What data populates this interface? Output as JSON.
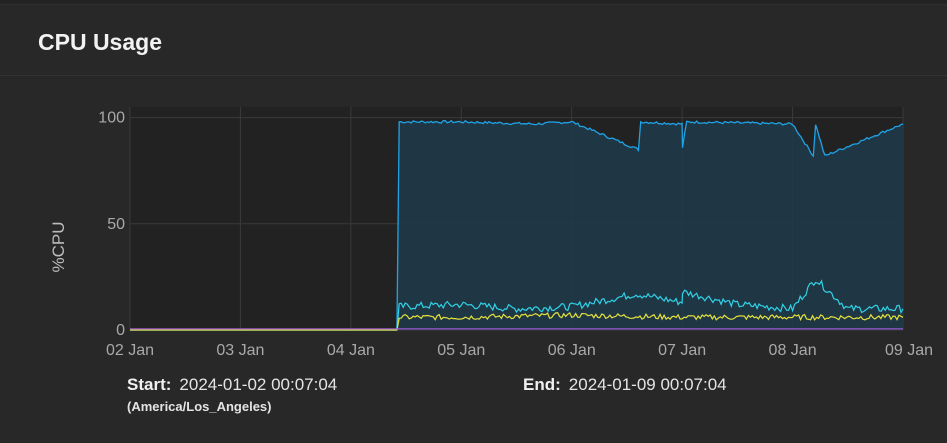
{
  "card": {
    "title": "CPU Usage"
  },
  "chart_data": {
    "type": "area",
    "title": "",
    "xlabel": "",
    "ylabel": "%CPU",
    "x_ticks": [
      "02 Jan",
      "03 Jan",
      "04 Jan",
      "05 Jan",
      "06 Jan",
      "07 Jan",
      "08 Jan",
      "09 Jan"
    ],
    "xlim": [
      "2024-01-02",
      "2024-01-09"
    ],
    "y_ticks": [
      0,
      50,
      100
    ],
    "ylim": [
      0,
      105
    ],
    "grid": true,
    "legend": "none",
    "colors": {
      "total": "#1fa3e6",
      "fill": "#1f3a4a",
      "series_cyan": "#2fd3e8",
      "series_yellow": "#e6e23c",
      "series_pink": "#e66aa6",
      "series_purple": "#9b59d0"
    },
    "series": [
      {
        "color": "#1fa3e6",
        "x": [
          "2024-01-02",
          "2024-01-03",
          "2024-01-04",
          "2024-01-04 10:00",
          "2024-01-04 10:30",
          "2024-01-05",
          "2024-01-05 16:00",
          "2024-01-06",
          "2024-01-06 14:30",
          "2024-01-06 15:00",
          "2024-01-07",
          "2024-01-07 00:05",
          "2024-01-07 01:00",
          "2024-01-08",
          "2024-01-08 04:30",
          "2024-01-08 05:00",
          "2024-01-08 07:00",
          "2024-01-09"
        ],
        "values": [
          0,
          0,
          0,
          0,
          98,
          98,
          97,
          98,
          85,
          98,
          97,
          86,
          98,
          97,
          82,
          97,
          82,
          97
        ]
      },
      {
        "color": "#2fd3e8",
        "x": [
          "2024-01-02",
          "2024-01-04 10:00",
          "2024-01-04 10:30",
          "2024-01-05",
          "2024-01-05 12:00",
          "2024-01-06",
          "2024-01-06 14:00",
          "2024-01-07",
          "2024-01-07 00:05",
          "2024-01-07 12:00",
          "2024-01-08",
          "2024-01-08 05:00",
          "2024-01-08 12:00",
          "2024-01-09"
        ],
        "values": [
          0,
          0,
          11,
          12,
          10,
          11,
          17,
          13,
          18,
          12,
          10,
          24,
          10,
          10
        ]
      },
      {
        "color": "#e6e23c",
        "x": [
          "2024-01-02",
          "2024-01-04 10:00",
          "2024-01-04 10:30",
          "2024-01-05",
          "2024-01-06",
          "2024-01-07",
          "2024-01-08",
          "2024-01-09"
        ],
        "values": [
          0,
          0,
          6,
          6,
          7,
          6,
          6,
          6
        ]
      },
      {
        "color": "#9b59d0",
        "x": [
          "2024-01-02",
          "2024-01-09"
        ],
        "values": [
          0.5,
          0.5
        ]
      }
    ]
  },
  "time_range": {
    "start_label": "Start:",
    "start_value": "2024-01-02 00:07:04",
    "timezone": "(America/Los_Angeles)",
    "end_label": "End:",
    "end_value": "2024-01-09 00:07:04"
  }
}
